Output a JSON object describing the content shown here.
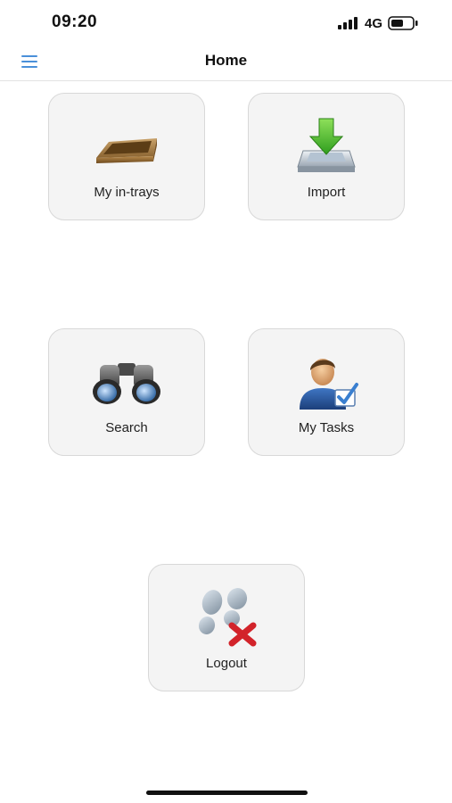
{
  "status_bar": {
    "time": "09:20",
    "network": "4G",
    "icons": [
      "signal-bars-icon",
      "battery-icon"
    ]
  },
  "nav": {
    "title": "Home",
    "menu_icon": "hamburger-menu-icon",
    "accent_color": "#4a90d9"
  },
  "tiles": [
    {
      "label": "My in-trays",
      "icon": "in-tray-icon"
    },
    {
      "label": "Import",
      "icon": "import-icon"
    },
    {
      "label": "Search",
      "icon": "binoculars-icon"
    },
    {
      "label": "My Tasks",
      "icon": "user-check-icon"
    },
    {
      "label": "Logout",
      "icon": "footprints-logout-icon"
    }
  ]
}
